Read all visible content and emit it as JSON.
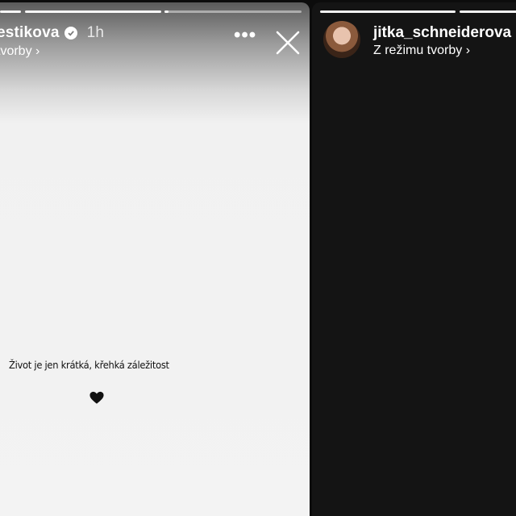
{
  "left_story": {
    "username": "estikova",
    "time": "1h",
    "subtitle": "tvorby ›",
    "more_label": "•••",
    "caption": "Život je jen krátká, křehká záležitost",
    "emoji": "black-heart",
    "progress": [
      1,
      1,
      0.02
    ]
  },
  "right_story": {
    "username": "jitka_schneiderova",
    "subtitle": "Z režimu tvorby ›",
    "progress": [
      1,
      1
    ]
  },
  "colors": {
    "right_bg": "#141414",
    "left_bg": "#f3f3f3",
    "text_dark": "#111111",
    "text_light": "#ffffff"
  }
}
